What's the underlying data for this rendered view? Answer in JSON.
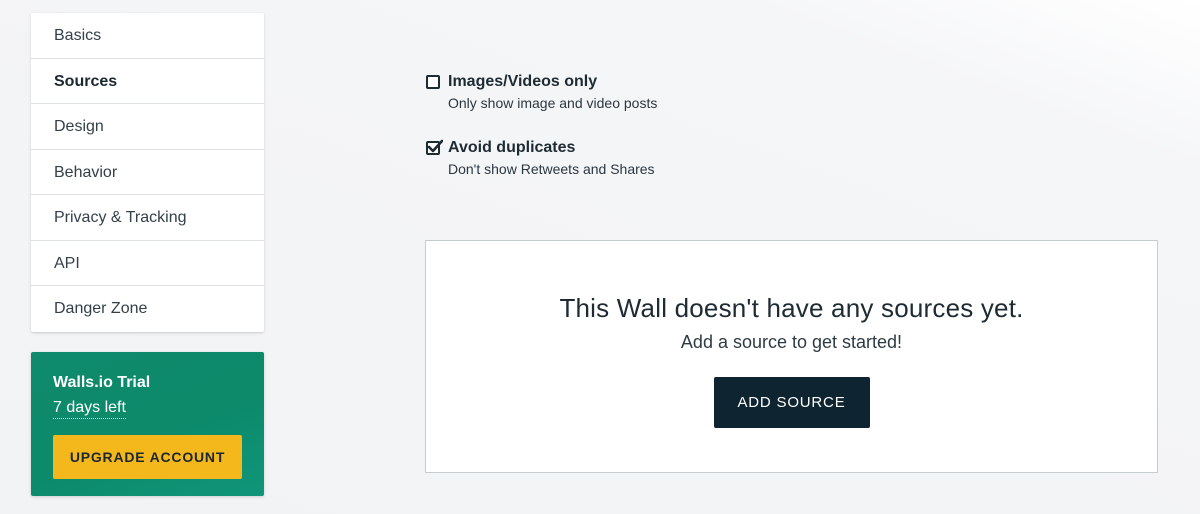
{
  "sidebar": {
    "items": [
      {
        "label": "Basics",
        "active": false
      },
      {
        "label": "Sources",
        "active": true
      },
      {
        "label": "Design",
        "active": false
      },
      {
        "label": "Behavior",
        "active": false
      },
      {
        "label": "Privacy & Tracking",
        "active": false
      },
      {
        "label": "API",
        "active": false
      },
      {
        "label": "Danger Zone",
        "active": false
      }
    ]
  },
  "trial": {
    "title": "Walls.io Trial",
    "days_left": "7 days left",
    "upgrade_label": "UPGRADE ACCOUNT",
    "background_color": "#0f8a6c",
    "button_color": "#f4b81c"
  },
  "options": [
    {
      "label": "Images/Videos only",
      "description": "Only show image and video posts",
      "checked": false
    },
    {
      "label": "Avoid duplicates",
      "description": "Don't show Retweets and Shares",
      "checked": true
    }
  ],
  "empty_state": {
    "title": "This Wall doesn't have any sources yet.",
    "subtitle": "Add a source to get started!",
    "button_label": "ADD SOURCE",
    "button_color": "#0f2431"
  }
}
